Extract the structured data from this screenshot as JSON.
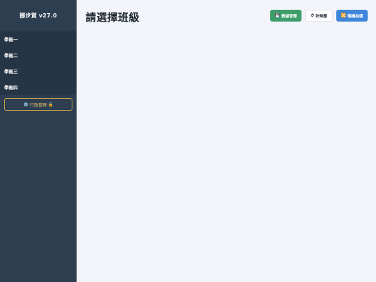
{
  "sidebar": {
    "brand": "挪步賞 v27.0",
    "items": [
      {
        "label": "學階一"
      },
      {
        "label": "學階二"
      },
      {
        "label": "學階三"
      },
      {
        "label": "學階四"
      }
    ],
    "admin": {
      "icon": "⚙️",
      "label": "行政管理",
      "lock": "🔒"
    }
  },
  "main": {
    "title": "請選擇班級",
    "buttons": {
      "data": {
        "icon": "💾",
        "label": "數據管理"
      },
      "timer": {
        "icon": "⏱",
        "label": "計時器"
      },
      "random": {
        "icon": "🔀",
        "label": "隨機抽選"
      }
    }
  },
  "colors": {
    "sidebar_bg": "#2d3e50",
    "menu_bg": "#263545",
    "main_bg": "#f3f5fa",
    "admin_border": "#c9a24a",
    "data_button": "#3e9e6b",
    "random_button": "#3d86d9"
  }
}
